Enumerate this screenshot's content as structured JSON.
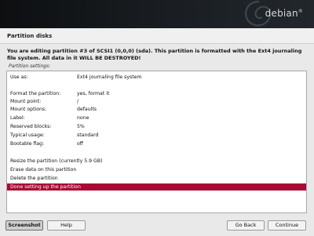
{
  "banner": {
    "brand": "debian",
    "trademark": "®"
  },
  "window": {
    "title": "Partition disks"
  },
  "message": {
    "warning": "You are editing partition #3 of SCSI1 (0,0,0) (sda). This partition is formatted with the Ext4 journaling file system. All data in it WILL BE DESTROYED!",
    "settings_label": "Partition settings:"
  },
  "settings": [
    {
      "key": "Use as:",
      "value": "Ext4 journaling file system"
    },
    {
      "key": "Format the partition:",
      "value": "yes, format it"
    },
    {
      "key": "Mount point:",
      "value": "/"
    },
    {
      "key": "Mount options:",
      "value": "defaults"
    },
    {
      "key": "Label:",
      "value": "none"
    },
    {
      "key": "Reserved blocks:",
      "value": "5%"
    },
    {
      "key": "Typical usage:",
      "value": "standard"
    },
    {
      "key": "Bootable flag:",
      "value": "off"
    }
  ],
  "actions": [
    "Resize the partition (currently 5.9 GB)",
    "Erase data on this partition",
    "Delete the partition",
    "Done setting up the partition"
  ],
  "selected_action_index": 3,
  "buttons": {
    "screenshot": "Screenshot",
    "help": "Help",
    "go_back": "Go Back",
    "continue": "Continue"
  },
  "colors": {
    "selection": "#a80a35",
    "banner": "#111417"
  }
}
